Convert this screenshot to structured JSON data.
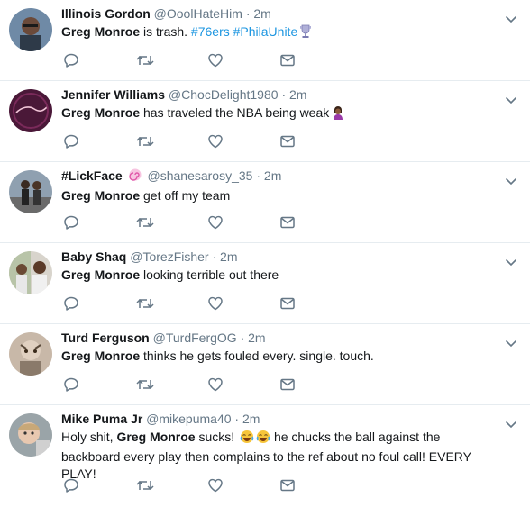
{
  "tweets": [
    {
      "name": "Illinois Gordon",
      "handle": "@OoolHateHim",
      "time": "2m",
      "parts": [
        {
          "t": "Greg Monroe",
          "s": "bold"
        },
        {
          "t": " is trash. ",
          "s": "plain"
        },
        {
          "t": "#76ers",
          "s": "hashtag"
        },
        {
          "t": " ",
          "s": "plain"
        },
        {
          "t": "#PhilaUnite",
          "s": "hashtag"
        }
      ],
      "trailing_emoji": "trophy-icon"
    },
    {
      "name": "Jennifer Williams",
      "handle": "@ChocDelight1980",
      "time": "2m",
      "parts": [
        {
          "t": "Greg Monroe",
          "s": "bold"
        },
        {
          "t": " has traveled the NBA being weak",
          "s": "plain"
        }
      ],
      "trailing_emoji": "woman-shrugging-icon"
    },
    {
      "name": "#LickFace",
      "handle": "@shanesarosy_35",
      "time": "2m",
      "parts": [
        {
          "t": "Greg Monroe",
          "s": "bold"
        },
        {
          "t": " get off my team",
          "s": "plain"
        }
      ],
      "name_emoji": "lollipop-icon"
    },
    {
      "name": "Baby Shaq",
      "handle": "@TorezFisher",
      "time": "2m",
      "parts": [
        {
          "t": "Greg Monroe",
          "s": "bold"
        },
        {
          "t": " looking terrible out there",
          "s": "plain"
        }
      ]
    },
    {
      "name": "Turd Ferguson",
      "handle": "@TurdFergOG",
      "time": "2m",
      "parts": [
        {
          "t": "Greg Monroe",
          "s": "bold"
        },
        {
          "t": " thinks he gets fouled every. single. touch.",
          "s": "plain"
        }
      ]
    },
    {
      "name": "Mike Puma Jr",
      "handle": "@mikepuma40",
      "time": "2m",
      "parts": [
        {
          "t": "Holy shit, ",
          "s": "plain"
        },
        {
          "t": "Greg Monroe",
          "s": "bold"
        },
        {
          "t": " sucks! ",
          "s": "plain"
        },
        {
          "t": "joy",
          "s": "emoji"
        },
        {
          "t": "joy",
          "s": "emoji"
        },
        {
          "t": " he chucks the ball against the backboard every play then complains to the ref about no foul call! EVERY PLAY!",
          "s": "plain"
        }
      ]
    }
  ],
  "icons": {
    "reply": "reply-icon",
    "retweet": "retweet-icon",
    "like": "heart-icon",
    "dm": "envelope-icon",
    "more": "chevron-down-icon"
  },
  "colors": {
    "hashtag": "#1b95e0",
    "meta": "#657786",
    "icon": "#657786",
    "divider": "#e6ecf0"
  }
}
